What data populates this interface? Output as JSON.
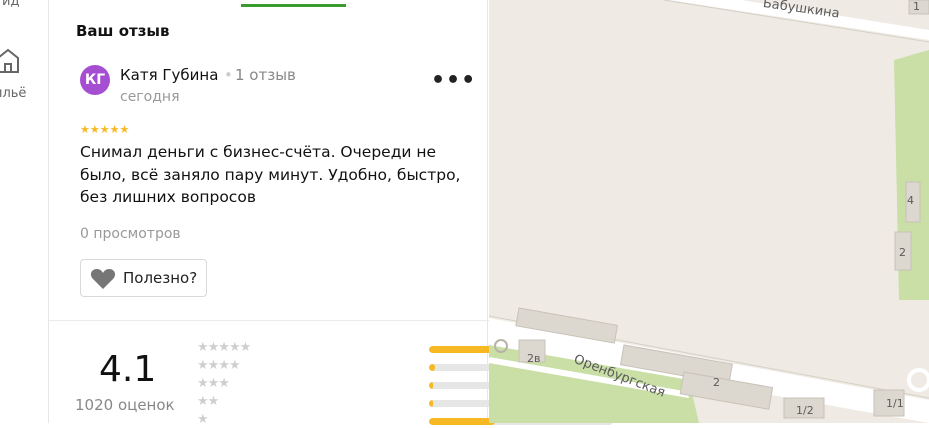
{
  "rail": {
    "top_label": "ид",
    "bottom_label": "ильё"
  },
  "review": {
    "section_title": "Ваш отзыв",
    "avatar_initials": "КГ",
    "avatar_color": "#a64ed1",
    "author_name": "Катя Губина",
    "separator": "•",
    "author_reviews": "1 отзыв",
    "date": "сегодня",
    "more_label": "•••",
    "rating": 5,
    "stars_text": "★★★★★",
    "text": "Снимал деньги с бизнес-счёта. Очереди не было, всё заняло пару минут. Удобно, быстро, без лишних вопросов",
    "views": "0 просмотров",
    "useful_label": "Полезно?"
  },
  "summary": {
    "rating": "4.1",
    "count": "1020 оценок",
    "distribution": [
      {
        "stars": "★★★★★",
        "fraction": 1.0
      },
      {
        "stars": "★★★★",
        "fraction": 0.03
      },
      {
        "stars": "★★★",
        "fraction": 0.02
      },
      {
        "stars": "★★",
        "fraction": 0.02
      },
      {
        "stars": "★",
        "fraction": 0.36
      }
    ]
  },
  "map": {
    "street_top": "Бабушкина",
    "street_bottom": "Оренбургская",
    "house_2v": "2в",
    "house_2_road": "2",
    "house_12": "1/2",
    "house_11": "1/1",
    "house_4": "4",
    "house_2_right": "2",
    "house_1": "1"
  },
  "colors": {
    "accent_green": "#3a9b2f",
    "star_yellow": "#f6b924",
    "map_bg": "#efebe4",
    "map_park": "#c9dfa5"
  }
}
